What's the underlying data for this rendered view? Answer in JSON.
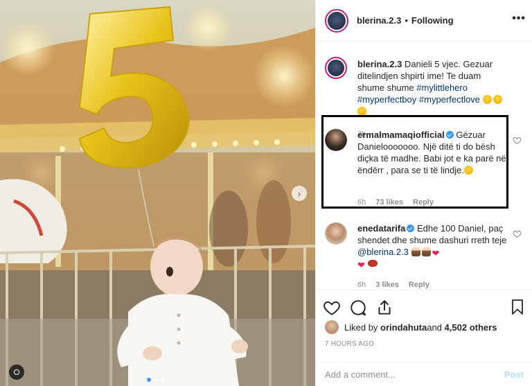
{
  "post": {
    "author": "blerina.2.3",
    "follow_status": "Following",
    "separator": "•",
    "more_label": "•••"
  },
  "caption": {
    "username": "blerina.2.3",
    "text": " Danieli 5 vjec. Gezuar ditelindjen shpirti ime! Te duam shume shume ",
    "hashtags": [
      "#mylittlehero",
      "#myperfectboy",
      "#myperfectlove"
    ],
    "age": "7h"
  },
  "comments": [
    {
      "username": "ermalmamaqiofficial",
      "text": " Gëzuar Danielooooooo. Një ditë ti do bësh diçka të madhe. Babi jot e ka parë në ëndërr , para se ti të lindje.",
      "age": "6h",
      "likes": "73 likes",
      "reply": "Reply"
    },
    {
      "username": "enedatarifa",
      "text": " Edhe 100 Daniel, paç shendet dhe shume dashuri rreth teje ",
      "mention": "@blerina.2.3",
      "age": "6h",
      "likes": "3 likes",
      "reply": "Reply"
    }
  ],
  "likes": {
    "prefix": "Liked by ",
    "user": "orindahuta",
    "joiner": " and ",
    "others": "4,502 others"
  },
  "timestamp": "7 HOURS AGO",
  "composer": {
    "placeholder": "Add a comment...",
    "post_label": "Post"
  },
  "photo": {
    "carousel_dots": 3,
    "active_dot": 0,
    "next_arrow": "›"
  },
  "colors": {
    "link": "#003569",
    "verified": "#3897f0",
    "post_disabled": "#b2dffc",
    "balloon_gold": "#e8c21a"
  }
}
